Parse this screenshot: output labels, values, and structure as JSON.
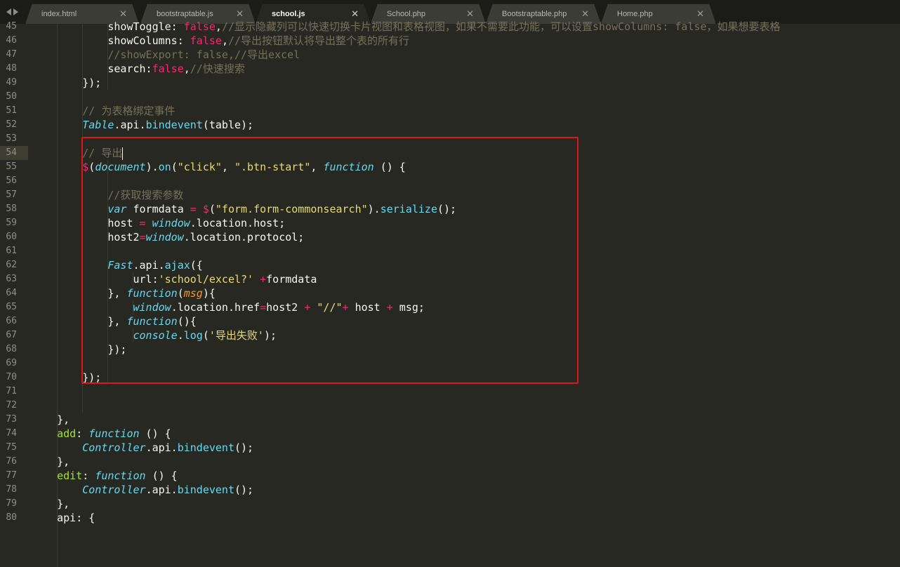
{
  "tabs": [
    {
      "label": "index.html",
      "active": false
    },
    {
      "label": "bootstraptable.js",
      "active": false
    },
    {
      "label": "school.js",
      "active": true
    },
    {
      "label": "School.php",
      "active": false
    },
    {
      "label": "Bootstraptable.php",
      "active": false
    },
    {
      "label": "Home.php",
      "active": false
    }
  ],
  "tab_close_glyph": "✕",
  "current_line": "54",
  "lines": [
    {
      "n": "45",
      "tokens": [
        [
          "p",
          "            showToggle: "
        ],
        [
          "k",
          "false"
        ],
        [
          "p",
          ","
        ],
        [
          "c",
          "//显示隐藏列可以快速切换卡片视图和表格视图，如果不需要此功能，可以设置showColumns: false，如果想要表格"
        ]
      ]
    },
    {
      "n": "46",
      "tokens": [
        [
          "p",
          "            showColumns: "
        ],
        [
          "k",
          "false"
        ],
        [
          "p",
          ","
        ],
        [
          "c",
          "//导出按钮默认将导出整个表的所有行"
        ]
      ]
    },
    {
      "n": "47",
      "tokens": [
        [
          "c",
          "            //showExport: false,//导出excel"
        ]
      ]
    },
    {
      "n": "48",
      "tokens": [
        [
          "p",
          "            search:"
        ],
        [
          "k",
          "false"
        ],
        [
          "p",
          ","
        ],
        [
          "c",
          "//快速搜索"
        ]
      ]
    },
    {
      "n": "49",
      "tokens": [
        [
          "p",
          "        });"
        ]
      ]
    },
    {
      "n": "50",
      "tokens": []
    },
    {
      "n": "51",
      "tokens": [
        [
          "c",
          "        // 为表格绑定事件"
        ]
      ]
    },
    {
      "n": "52",
      "tokens": [
        [
          "p",
          "        "
        ],
        [
          "y",
          "Table"
        ],
        [
          "p",
          "."
        ],
        [
          "p",
          "api"
        ],
        [
          "p",
          "."
        ],
        [
          "f",
          "bindevent"
        ],
        [
          "p",
          "(table);"
        ]
      ]
    },
    {
      "n": "53",
      "tokens": []
    },
    {
      "n": "54",
      "tokens": [
        [
          "c",
          "        // 导出"
        ]
      ]
    },
    {
      "n": "55",
      "tokens": [
        [
          "p",
          "        "
        ],
        [
          "k",
          "$"
        ],
        [
          "p",
          "("
        ],
        [
          "y",
          "document"
        ],
        [
          "p",
          ")."
        ],
        [
          "f",
          "on"
        ],
        [
          "p",
          "("
        ],
        [
          "s",
          "\"click\""
        ],
        [
          "p",
          ", "
        ],
        [
          "s",
          "\".btn-start\""
        ],
        [
          "p",
          ", "
        ],
        [
          "y",
          "function"
        ],
        [
          "p",
          " () {"
        ]
      ]
    },
    {
      "n": "56",
      "tokens": []
    },
    {
      "n": "57",
      "tokens": [
        [
          "c",
          "            //获取搜索参数"
        ]
      ]
    },
    {
      "n": "58",
      "tokens": [
        [
          "p",
          "            "
        ],
        [
          "y",
          "var"
        ],
        [
          "p",
          " formdata "
        ],
        [
          "k",
          "="
        ],
        [
          "p",
          " "
        ],
        [
          "k",
          "$"
        ],
        [
          "p",
          "("
        ],
        [
          "s",
          "\"form.form-commonsearch\""
        ],
        [
          "p",
          ")."
        ],
        [
          "f",
          "serialize"
        ],
        [
          "p",
          "();"
        ]
      ]
    },
    {
      "n": "59",
      "tokens": [
        [
          "p",
          "            host "
        ],
        [
          "k",
          "="
        ],
        [
          "p",
          " "
        ],
        [
          "y",
          "window"
        ],
        [
          "p",
          ".location.host;"
        ]
      ]
    },
    {
      "n": "60",
      "tokens": [
        [
          "p",
          "            host2"
        ],
        [
          "k",
          "="
        ],
        [
          "y",
          "window"
        ],
        [
          "p",
          ".location.protocol;"
        ]
      ]
    },
    {
      "n": "61",
      "tokens": []
    },
    {
      "n": "62",
      "tokens": [
        [
          "p",
          "            "
        ],
        [
          "y",
          "Fast"
        ],
        [
          "p",
          ".api."
        ],
        [
          "f",
          "ajax"
        ],
        [
          "p",
          "({"
        ]
      ]
    },
    {
      "n": "63",
      "tokens": [
        [
          "p",
          "                url:"
        ],
        [
          "s",
          "'school/excel?'"
        ],
        [
          "p",
          " "
        ],
        [
          "k",
          "+"
        ],
        [
          "p",
          "formdata"
        ]
      ]
    },
    {
      "n": "64",
      "tokens": [
        [
          "p",
          "            }, "
        ],
        [
          "y",
          "function"
        ],
        [
          "p",
          "("
        ],
        [
          "o",
          "msg"
        ],
        [
          "p",
          "){"
        ]
      ]
    },
    {
      "n": "65",
      "tokens": [
        [
          "p",
          "                "
        ],
        [
          "y",
          "window"
        ],
        [
          "p",
          ".location.href"
        ],
        [
          "k",
          "="
        ],
        [
          "p",
          "host2 "
        ],
        [
          "k",
          "+"
        ],
        [
          "p",
          " "
        ],
        [
          "s",
          "\"//\""
        ],
        [
          "k",
          "+"
        ],
        [
          "p",
          " host "
        ],
        [
          "k",
          "+"
        ],
        [
          "p",
          " msg;"
        ]
      ]
    },
    {
      "n": "66",
      "tokens": [
        [
          "p",
          "            }, "
        ],
        [
          "y",
          "function"
        ],
        [
          "p",
          "(){"
        ]
      ]
    },
    {
      "n": "67",
      "tokens": [
        [
          "p",
          "                "
        ],
        [
          "y",
          "console"
        ],
        [
          "p",
          "."
        ],
        [
          "f",
          "log"
        ],
        [
          "p",
          "("
        ],
        [
          "s",
          "'导出失败'"
        ],
        [
          "p",
          ");"
        ]
      ]
    },
    {
      "n": "68",
      "tokens": [
        [
          "p",
          "            });"
        ]
      ]
    },
    {
      "n": "69",
      "tokens": []
    },
    {
      "n": "70",
      "tokens": [
        [
          "p",
          "        });"
        ]
      ]
    },
    {
      "n": "71",
      "tokens": []
    },
    {
      "n": "72",
      "tokens": []
    },
    {
      "n": "73",
      "tokens": [
        [
          "p",
          "    },"
        ]
      ]
    },
    {
      "n": "74",
      "tokens": [
        [
          "a",
          "    add"
        ],
        [
          "p",
          ": "
        ],
        [
          "y",
          "function"
        ],
        [
          "p",
          " () {"
        ]
      ]
    },
    {
      "n": "75",
      "tokens": [
        [
          "p",
          "        "
        ],
        [
          "y",
          "Controller"
        ],
        [
          "p",
          ".api."
        ],
        [
          "f",
          "bindevent"
        ],
        [
          "p",
          "();"
        ]
      ]
    },
    {
      "n": "76",
      "tokens": [
        [
          "p",
          "    },"
        ]
      ]
    },
    {
      "n": "77",
      "tokens": [
        [
          "a",
          "    edit"
        ],
        [
          "p",
          ": "
        ],
        [
          "y",
          "function"
        ],
        [
          "p",
          " () {"
        ]
      ]
    },
    {
      "n": "78",
      "tokens": [
        [
          "p",
          "        "
        ],
        [
          "y",
          "Controller"
        ],
        [
          "p",
          ".api."
        ],
        [
          "f",
          "bindevent"
        ],
        [
          "p",
          "();"
        ]
      ]
    },
    {
      "n": "79",
      "tokens": [
        [
          "p",
          "    },"
        ]
      ]
    },
    {
      "n": "80",
      "tokens": [
        [
          "p",
          "    api: {"
        ]
      ]
    }
  ],
  "colors": {
    "background": "#272822",
    "highlight_box": "#e0141e"
  }
}
